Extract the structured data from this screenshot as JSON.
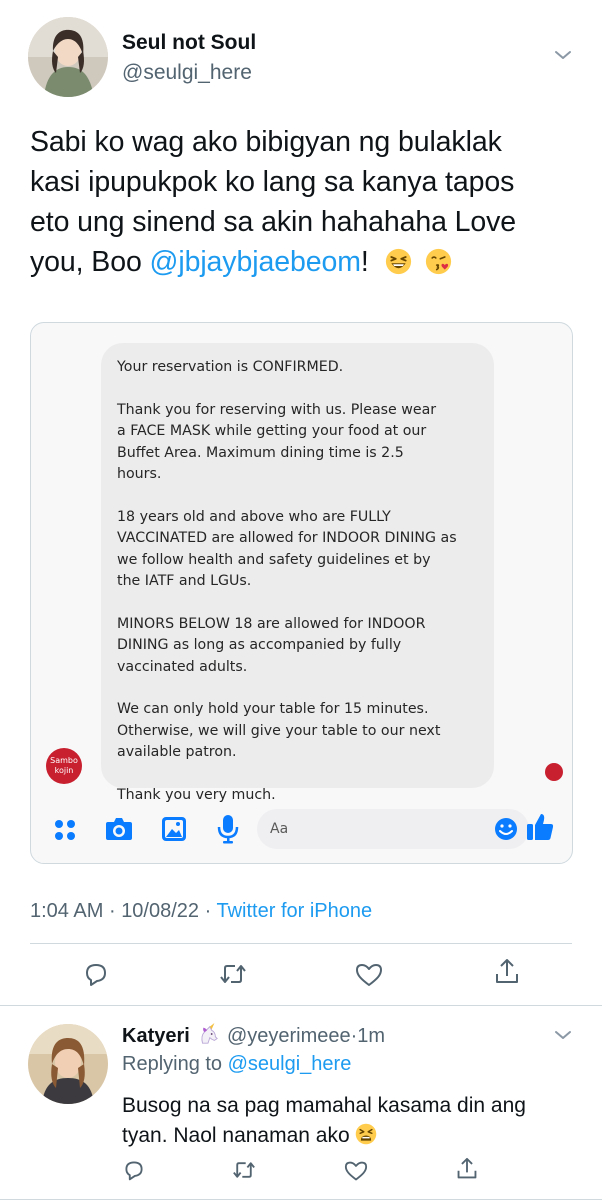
{
  "tweet": {
    "author_name": "Seul not Soul",
    "author_handle": "@seulgi_here",
    "text_lines": [
      "Sabi ko wag ako bibigyan ng bulaklak",
      "kasi ipupukpok ko lang sa kanya tapos",
      "eto ung sinend sa akin hahahaha Love"
    ],
    "text_last_prefix": "you, Boo ",
    "text_mention": "@jbjaybjaebeom",
    "text_last_suffix": "!",
    "emojis": [
      "grinning-squinting-face",
      "face-blowing-kiss"
    ],
    "time": "1:04 AM",
    "date": "10/08/22",
    "source": "Twitter for iPhone",
    "separator": "·"
  },
  "screenshot": {
    "message_paragraphs": [
      "Your reservation is CONFIRMED.",
      "Thank you for reserving with us. Please wear\na FACE MASK while getting your food at our\nBuffet Area. Maximum dining time is 2.5\nhours.",
      "18 years old and above who are FULLY\nVACCINATED are allowed for INDOOR DINING as\nwe follow health and safety guidelines et by\nthe IATF and LGUs.",
      "MINORS BELOW 18 are allowed for INDOOR\nDINING as long as accompanied by fully\nvaccinated adults.",
      "We can only hold your table for 15 minutes.\nOtherwise, we will give your table to our next\navailable patron.",
      "Thank you very much."
    ],
    "page_logo_text": "Sambo\nkojin",
    "composer_placeholder": "Aa",
    "composer_icons": [
      "menu-dots-icon",
      "camera-icon",
      "gallery-icon",
      "microphone-icon",
      "emoji-icon",
      "thumbs-up-icon"
    ],
    "accent_color": "#0a7cff",
    "logo_color": "#c8202f"
  },
  "actions": [
    "reply-icon",
    "retweet-icon",
    "like-icon",
    "share-icon"
  ],
  "reply": {
    "author_name": "Katyeri",
    "author_emoji": "unicorn",
    "author_handle": "@yeyerimeee",
    "separator": "·",
    "time_ago": "1m",
    "replying_prefix": "Replying to ",
    "replying_to": "@seulgi_here",
    "text_lines": [
      "Busog na sa pag mamahal kasama din ang",
      "tyan. Naol nanaman ako "
    ],
    "emoji": "tired-face"
  },
  "colors": {
    "link": "#1d9bf0",
    "secondary_text": "#536471",
    "primary_text": "#0f1419",
    "divider": "#cfd9de"
  }
}
